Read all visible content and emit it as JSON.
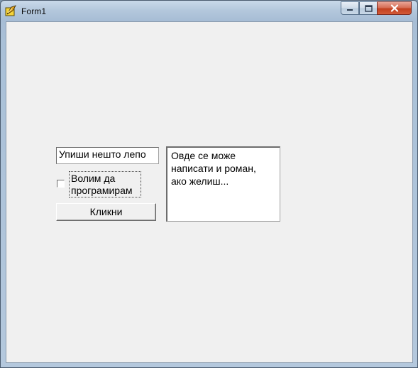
{
  "window": {
    "title": "Form1",
    "icon": "delphi-app-icon",
    "controls": {
      "minimize_icon": "minimize-icon",
      "maximize_icon": "maximize-icon",
      "close_icon": "close-icon"
    }
  },
  "form": {
    "edit_value": "Упиши нешто лепо",
    "checkbox_label": "Волим  да\nпрограмирам",
    "checkbox_checked": false,
    "button_label": "Кликни",
    "memo_text": "Овде се може\nнаписати и роман,\nако желиш..."
  },
  "colors": {
    "client_background": "#f0f0f0",
    "close_button": "#c2401f",
    "title_bar": "#b3c7dc"
  }
}
